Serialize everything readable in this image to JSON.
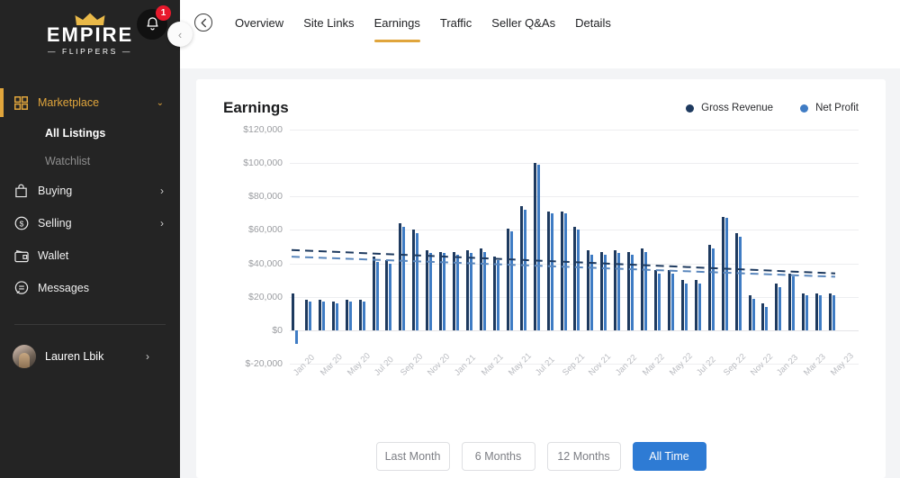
{
  "sidebar": {
    "logo": {
      "line1": "EMPIRE",
      "line2": "— FLIPPERS —"
    },
    "notification_count": "1",
    "collapse_label": "‹",
    "items": [
      {
        "label": "Marketplace",
        "icon": "grid-icon",
        "state": "active",
        "chevron": "⌄"
      },
      {
        "label": "All Listings",
        "icon": "none",
        "state": "sub"
      },
      {
        "label": "Watchlist",
        "icon": "none",
        "state": "sub-muted"
      },
      {
        "label": "Buying",
        "icon": "bag-icon",
        "state": "normal",
        "chevron": "›"
      },
      {
        "label": "Selling",
        "icon": "dollar-circle-icon",
        "state": "normal",
        "chevron": "›"
      },
      {
        "label": "Wallet",
        "icon": "wallet-icon",
        "state": "normal"
      },
      {
        "label": "Messages",
        "icon": "chat-icon",
        "state": "normal"
      }
    ],
    "user": {
      "name": "Lauren Lbik",
      "chevron": "›"
    }
  },
  "topbar": {
    "back_label": "←",
    "tabs": [
      {
        "label": "Overview",
        "active": false
      },
      {
        "label": "Site Links",
        "active": false
      },
      {
        "label": "Earnings",
        "active": true
      },
      {
        "label": "Traffic",
        "active": false
      },
      {
        "label": "Seller Q&As",
        "active": false
      },
      {
        "label": "Details",
        "active": false
      }
    ]
  },
  "card": {
    "title": "Earnings",
    "legend": [
      {
        "label": "Gross Revenue",
        "color": "#1e3a5f"
      },
      {
        "label": "Net Profit",
        "color": "#3f7cc4"
      }
    ],
    "ranges": [
      {
        "label": "Last Month",
        "active": false
      },
      {
        "label": "6 Months",
        "active": false
      },
      {
        "label": "12 Months",
        "active": false
      },
      {
        "label": "All Time",
        "active": true
      }
    ]
  },
  "chart_data": {
    "type": "bar",
    "title": "Earnings",
    "xlabel": "",
    "ylabel": "",
    "ylim": [
      -20000,
      120000
    ],
    "ytick_labels": [
      "$120,000",
      "$100,000",
      "$80,000",
      "$60,000",
      "$40,000",
      "$20,000",
      "$0",
      "$-20,000"
    ],
    "yticks": [
      120000,
      100000,
      80000,
      60000,
      40000,
      20000,
      0,
      -20000
    ],
    "grid": true,
    "legend_position": "top-right",
    "x": [
      "Jan 20",
      "Feb 20",
      "Mar 20",
      "Apr 20",
      "May 20",
      "Jun 20",
      "Jul 20",
      "Aug 20",
      "Sep 20",
      "Oct 20",
      "Nov 20",
      "Dec 20",
      "Jan 21",
      "Feb 21",
      "Mar 21",
      "Apr 21",
      "May 21",
      "Jun 21",
      "Jul 21",
      "Aug 21",
      "Sep 21",
      "Oct 21",
      "Nov 21",
      "Dec 21",
      "Jan 22",
      "Feb 22",
      "Mar 22",
      "Apr 22",
      "May 22",
      "Jun 22",
      "Jul 22",
      "Aug 22",
      "Sep 22",
      "Oct 22",
      "Nov 22",
      "Dec 22",
      "Jan 23",
      "Feb 23",
      "Mar 23",
      "Apr 23",
      "May 23"
    ],
    "xtick_labels": [
      "Jan 20",
      "Mar 20",
      "May 20",
      "Jul 20",
      "Sep 20",
      "Nov 20",
      "Jan 21",
      "Mar 21",
      "May 21",
      "Jul 21",
      "Sep 21",
      "Nov 21",
      "Jan 22",
      "Mar 22",
      "May 22",
      "Jul 22",
      "Sep 22",
      "Nov 22",
      "Jan 23",
      "Mar 23",
      "May 23"
    ],
    "series": [
      {
        "name": "Gross Revenue",
        "color": "#1e3a5f",
        "values": [
          22000,
          18000,
          18000,
          17000,
          18000,
          18000,
          44000,
          42000,
          64000,
          60000,
          48000,
          47000,
          47000,
          48000,
          49000,
          44000,
          61000,
          74000,
          100000,
          71000,
          71000,
          62000,
          48000,
          47000,
          48000,
          47000,
          49000,
          36000,
          36000,
          30000,
          30000,
          51000,
          68000,
          58000,
          21000,
          16000,
          28000,
          34000,
          22000,
          22000,
          22000
        ]
      },
      {
        "name": "Net Profit",
        "color": "#3f7cc4",
        "values": [
          -8000,
          17000,
          17000,
          16000,
          17000,
          17000,
          41000,
          40000,
          62000,
          58000,
          46000,
          46000,
          45000,
          46000,
          47000,
          42000,
          59000,
          72000,
          99000,
          70000,
          70000,
          60000,
          45000,
          45000,
          46000,
          45000,
          47000,
          34000,
          34000,
          28000,
          28000,
          49000,
          67000,
          56000,
          19000,
          14000,
          26000,
          32000,
          21000,
          21000,
          21000
        ]
      }
    ],
    "trendlines": [
      {
        "name": "Gross Revenue trend",
        "color": "#1e3a5f",
        "style": "dashed",
        "start": 48000,
        "end": 34000
      },
      {
        "name": "Net Profit trend",
        "color": "#5a87bd",
        "style": "dashed",
        "start": 44000,
        "end": 32000
      }
    ]
  }
}
